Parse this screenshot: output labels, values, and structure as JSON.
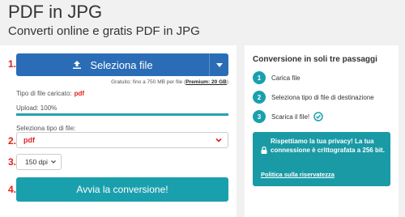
{
  "header": {
    "title": "PDF in JPG",
    "subtitle": "Converti online e gratis PDF in JPG"
  },
  "steps": {
    "one": "1.",
    "two": "2.",
    "three": "3.",
    "four": "4."
  },
  "upload": {
    "select_button": "Seleziona file",
    "limit_prefix": "Gratuito: fino a 750 MB per file (",
    "limit_link": "Premium: 20 GB",
    "limit_suffix": ")",
    "filetype_label": "Tipo di file caricato:",
    "filetype_value": "pdf",
    "progress_label": "Upload: 100%",
    "progress_fraction": 1.0
  },
  "target": {
    "label": "Seleziona tipo di file:",
    "selected": "pdf"
  },
  "dpi": {
    "selected": "150 dpi"
  },
  "convert": {
    "label": "Avvia la conversione!"
  },
  "sidebar": {
    "title": "Conversione in soli tre passaggi",
    "items": [
      {
        "num": "1",
        "label": "Carica file"
      },
      {
        "num": "2",
        "label": "Seleziona tipo di file di destinazione"
      },
      {
        "num": "3",
        "label": "Scarica il file!"
      }
    ],
    "privacy_text": "Rispettiamo la tua privacy! La tua connessione è crittografata a 256 bit.",
    "privacy_link": "Politica sulla riservatezza"
  },
  "colors": {
    "primary_blue": "#2a6db6",
    "teal": "#1aa0ad",
    "step_red": "#e02020"
  }
}
